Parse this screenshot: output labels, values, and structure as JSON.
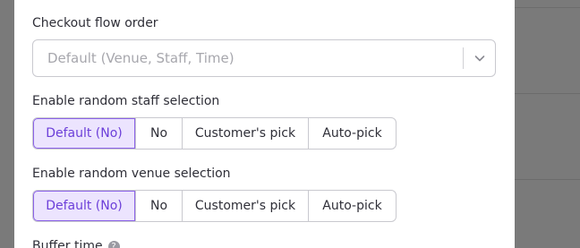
{
  "checkout_flow": {
    "label": "Checkout flow order",
    "value": "Default (Venue, Staff, Time)"
  },
  "random_staff": {
    "label": "Enable random staff selection",
    "options": [
      "Default (No)",
      "No",
      "Customer's pick",
      "Auto-pick"
    ],
    "selected": "Default (No)"
  },
  "random_venue": {
    "label": "Enable random venue selection",
    "options": [
      "Default (No)",
      "No",
      "Customer's pick",
      "Auto-pick"
    ],
    "selected": "Default (No)"
  },
  "buffer_time": {
    "label": "Buffer time",
    "help_icon": "?"
  },
  "colors": {
    "accent": "#6c3fd9",
    "selected_bg": "#ece4fe",
    "overlay": "#7a7a7a"
  },
  "icons": [
    "chevron-down-icon",
    "help-icon"
  ]
}
